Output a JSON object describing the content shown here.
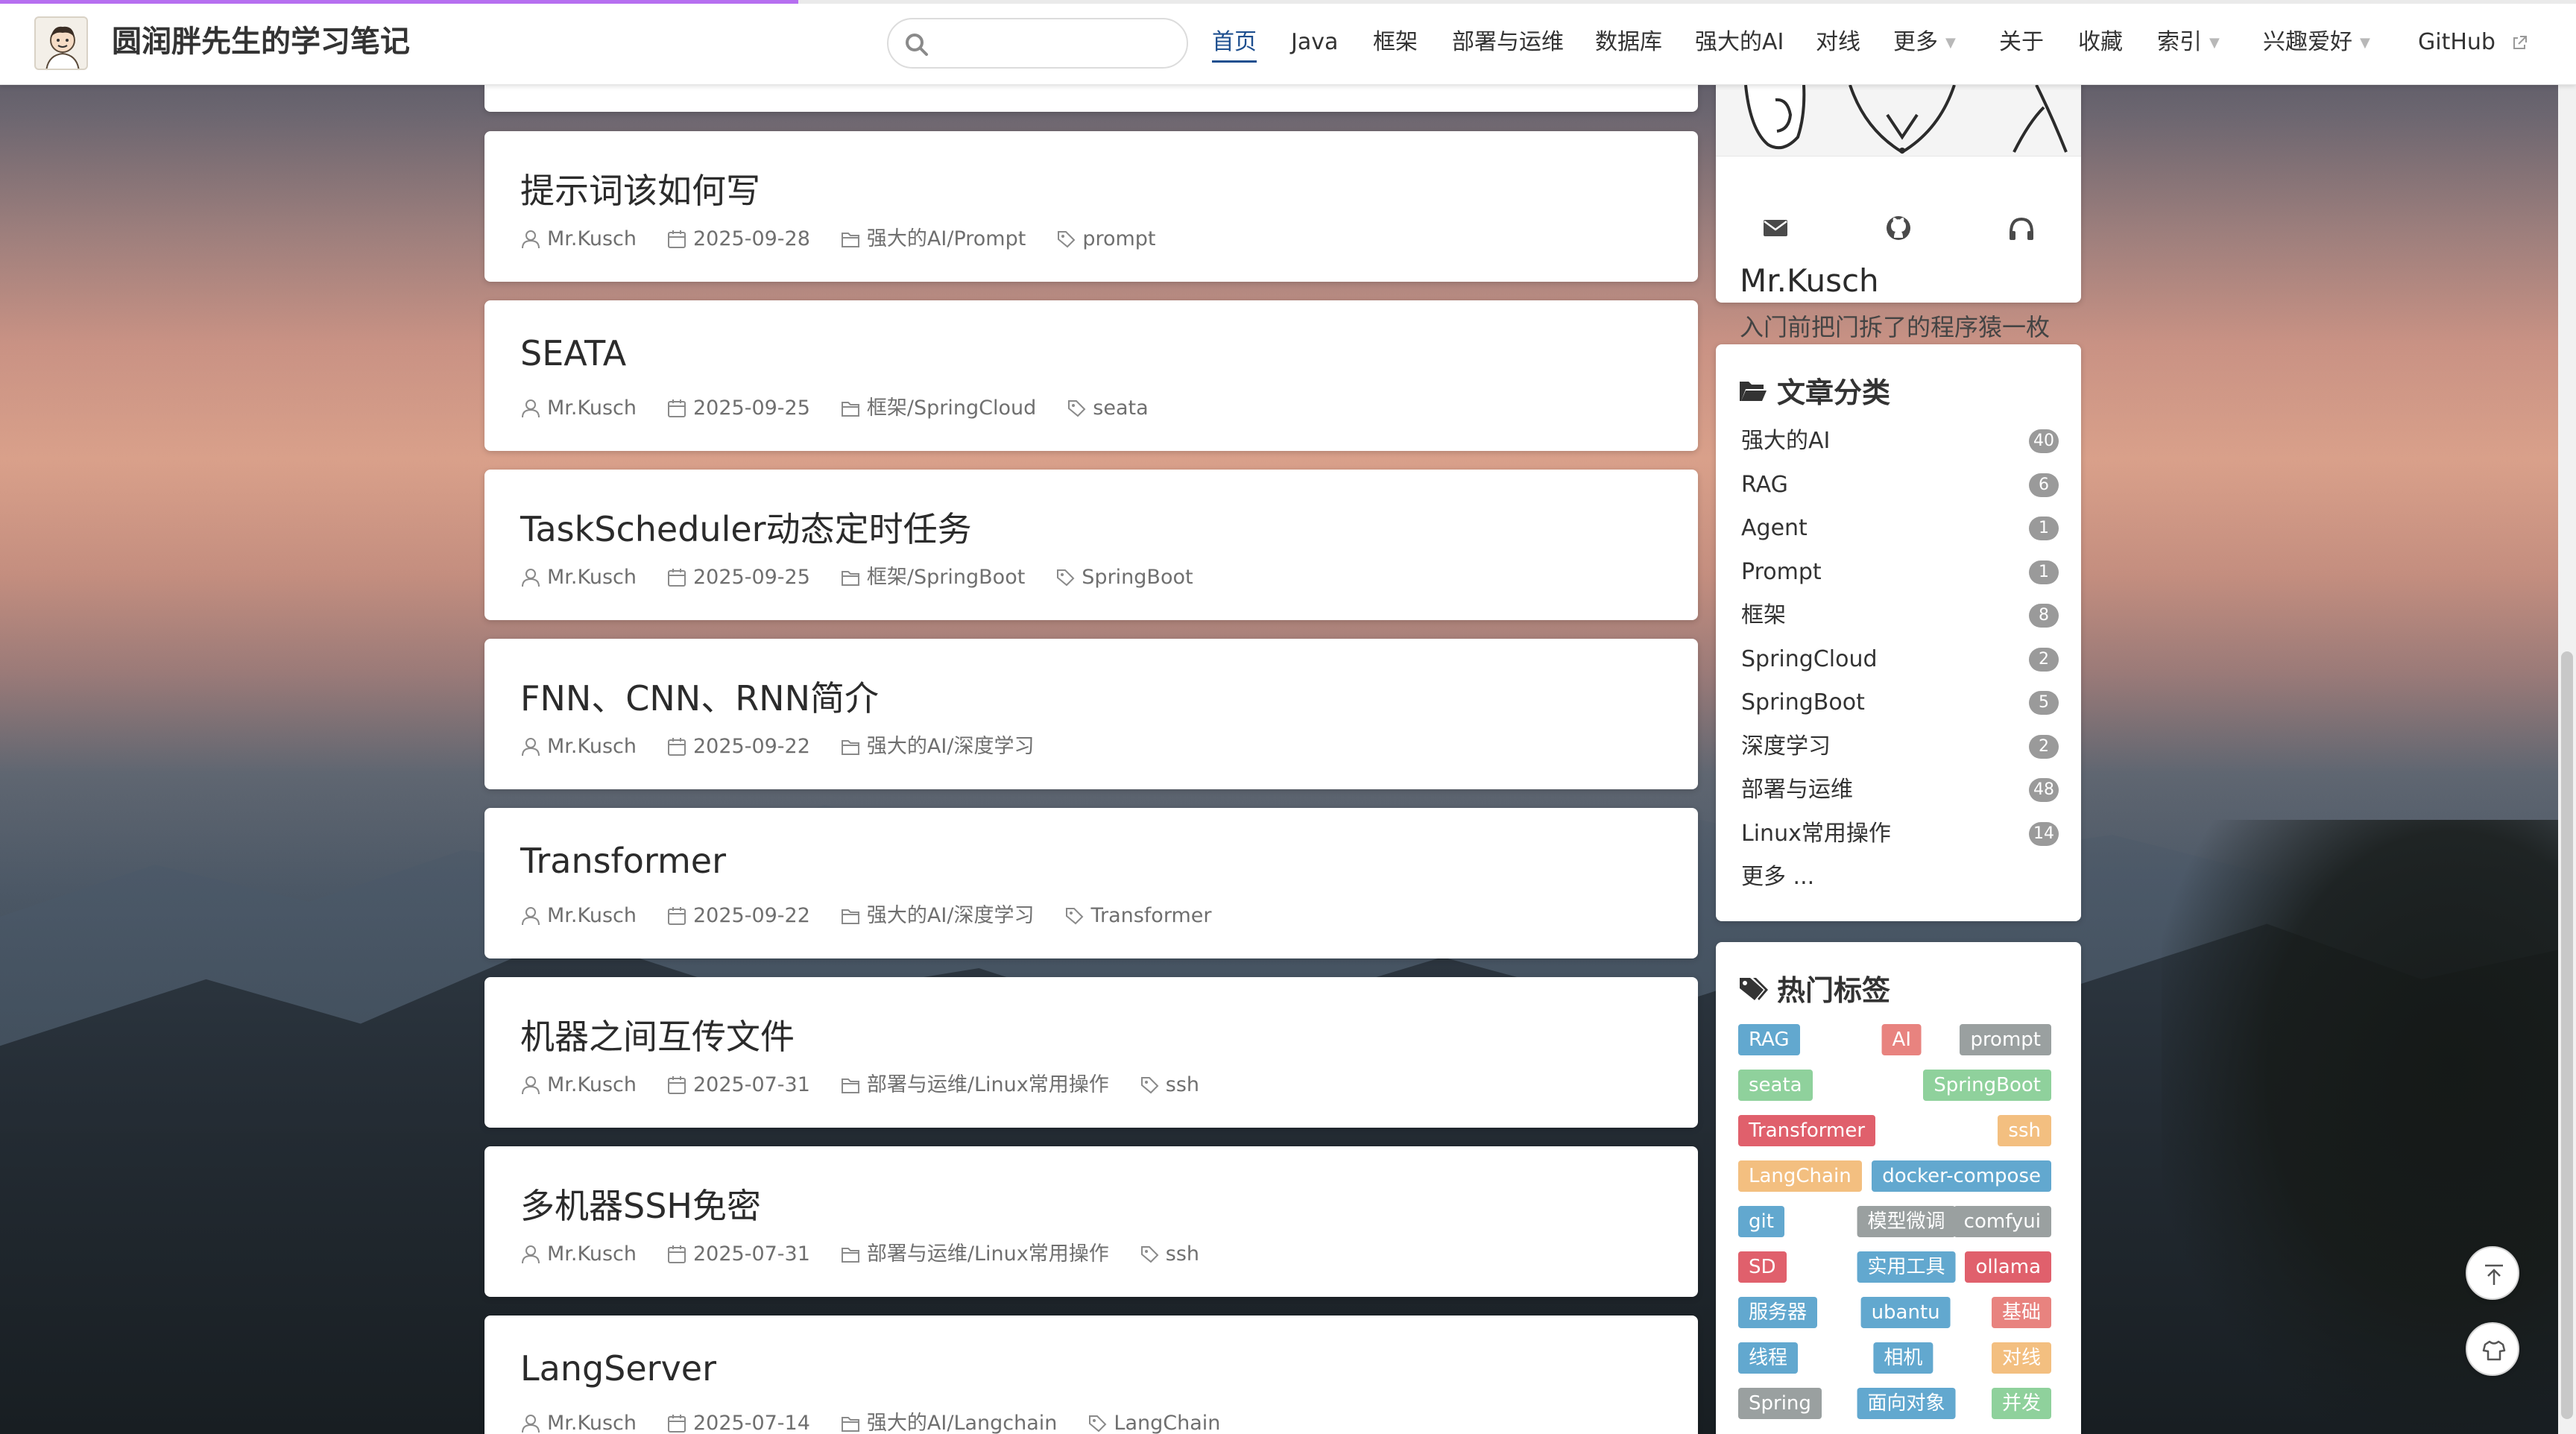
{
  "header": {
    "site_title": "圆润胖先生的学习笔记",
    "search_placeholder": "",
    "progress": 0.31,
    "nav": [
      {
        "label": "首页",
        "active": true,
        "dropdown": false
      },
      {
        "label": "Java",
        "active": false,
        "dropdown": false
      },
      {
        "label": "框架",
        "active": false,
        "dropdown": false
      },
      {
        "label": "部署与运维",
        "active": false,
        "dropdown": false
      },
      {
        "label": "数据库",
        "active": false,
        "dropdown": false
      },
      {
        "label": "强大的AI",
        "active": false,
        "dropdown": false
      },
      {
        "label": "对线",
        "active": false,
        "dropdown": false
      },
      {
        "label": "更多",
        "active": false,
        "dropdown": true
      },
      {
        "label": "关于",
        "active": false,
        "dropdown": false
      },
      {
        "label": "收藏",
        "active": false,
        "dropdown": false
      },
      {
        "label": "索引",
        "active": false,
        "dropdown": true
      },
      {
        "label": "兴趣爱好",
        "active": false,
        "dropdown": true
      },
      {
        "label": "GitHub",
        "active": false,
        "dropdown": false,
        "external": true
      }
    ]
  },
  "posts": [
    {
      "title": "提示词该如何写",
      "author": "Mr.Kusch",
      "date": "2025-09-28",
      "category": "强大的AI/Prompt",
      "tag": "prompt"
    },
    {
      "title": "SEATA",
      "author": "Mr.Kusch",
      "date": "2025-09-25",
      "category": "框架/SpringCloud",
      "tag": "seata"
    },
    {
      "title": "TaskScheduler动态定时任务",
      "author": "Mr.Kusch",
      "date": "2025-09-25",
      "category": "框架/SpringBoot",
      "tag": "SpringBoot"
    },
    {
      "title": "FNN、CNN、RNN简介",
      "author": "Mr.Kusch",
      "date": "2025-09-22",
      "category": "强大的AI/深度学习",
      "tag": ""
    },
    {
      "title": "Transformer",
      "author": "Mr.Kusch",
      "date": "2025-09-22",
      "category": "强大的AI/深度学习",
      "tag": "Transformer"
    },
    {
      "title": "机器之间互传文件",
      "author": "Mr.Kusch",
      "date": "2025-07-31",
      "category": "部署与运维/Linux常用操作",
      "tag": "ssh"
    },
    {
      "title": "多机器SSH免密",
      "author": "Mr.Kusch",
      "date": "2025-07-31",
      "category": "部署与运维/Linux常用操作",
      "tag": "ssh"
    },
    {
      "title": "LangServer",
      "author": "Mr.Kusch",
      "date": "2025-07-14",
      "category": "强大的AI/Langchain",
      "tag": "LangChain"
    }
  ],
  "profile": {
    "name": "Mr.Kusch",
    "bio": "入门前把门拆了的程序猿一枚",
    "social_icons": [
      "mail-icon",
      "github-icon",
      "headphones-icon"
    ]
  },
  "categories": {
    "heading": "文章分类",
    "items": [
      {
        "label": "强大的AI",
        "count": "40"
      },
      {
        "label": "RAG",
        "count": "6"
      },
      {
        "label": "Agent",
        "count": "1"
      },
      {
        "label": "Prompt",
        "count": "1"
      },
      {
        "label": "框架",
        "count": "8"
      },
      {
        "label": "SpringCloud",
        "count": "2"
      },
      {
        "label": "SpringBoot",
        "count": "5"
      },
      {
        "label": "深度学习",
        "count": "2"
      },
      {
        "label": "部署与运维",
        "count": "48"
      },
      {
        "label": "Linux常用操作",
        "count": "14"
      }
    ],
    "more_label": "更多 ..."
  },
  "tags": {
    "heading": "热门标签",
    "items": [
      {
        "label": "RAG",
        "color": "#62a8cf"
      },
      {
        "label": "AI",
        "color": "#e8837f"
      },
      {
        "label": "prompt",
        "color": "#9aa0a0"
      },
      {
        "label": "seata",
        "color": "#8fd19c"
      },
      {
        "label": "SpringBoot",
        "color": "#8fd19c"
      },
      {
        "label": "Transformer",
        "color": "#e0606c"
      },
      {
        "label": "ssh",
        "color": "#f3bf80"
      },
      {
        "label": "LangChain",
        "color": "#f3bf80"
      },
      {
        "label": "docker-compose",
        "color": "#62a8cf"
      },
      {
        "label": "git",
        "color": "#62a8cf"
      },
      {
        "label": "模型微调",
        "color": "#9aa0a0"
      },
      {
        "label": "comfyui",
        "color": "#9aa0a0"
      },
      {
        "label": "SD",
        "color": "#e0606c"
      },
      {
        "label": "实用工具",
        "color": "#62a8cf"
      },
      {
        "label": "ollama",
        "color": "#e0606c"
      },
      {
        "label": "服务器",
        "color": "#62a8cf"
      },
      {
        "label": "ubantu",
        "color": "#62a8cf"
      },
      {
        "label": "基础",
        "color": "#e8837f"
      },
      {
        "label": "线程",
        "color": "#62a8cf"
      },
      {
        "label": "相机",
        "color": "#62a8cf"
      },
      {
        "label": "对线",
        "color": "#f3bf80"
      },
      {
        "label": "Spring",
        "color": "#9aa0a0"
      },
      {
        "label": "面向对象",
        "color": "#62a8cf"
      },
      {
        "label": "并发",
        "color": "#8fd19c"
      }
    ]
  },
  "floating": {
    "top_icon": "arrow-up-icon",
    "theme_icon": "shirt-icon"
  }
}
